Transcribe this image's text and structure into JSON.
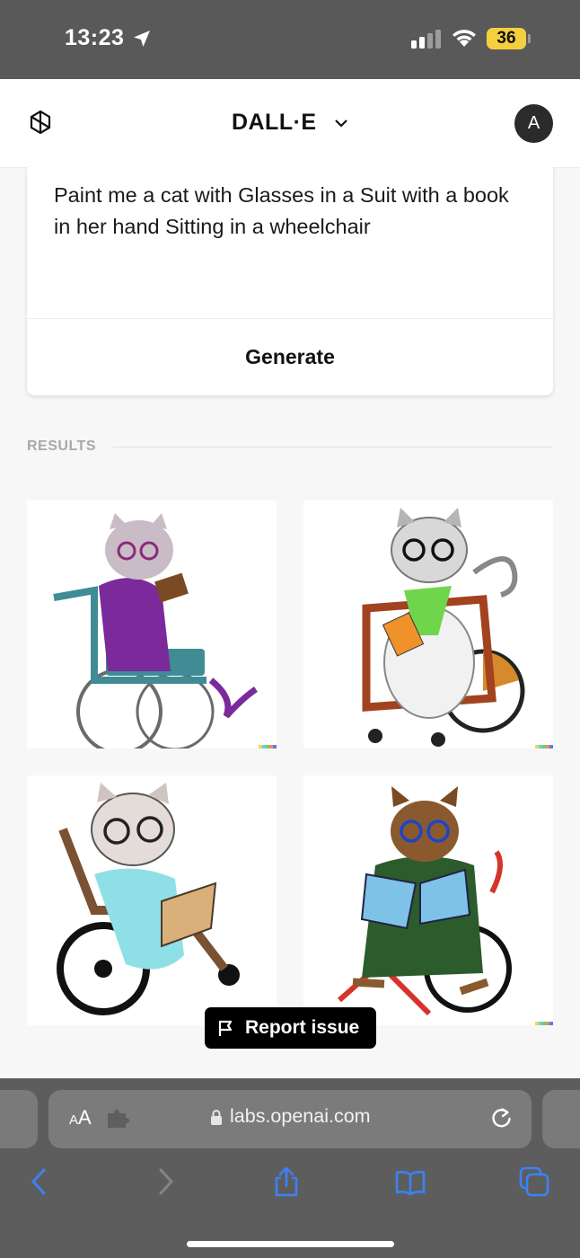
{
  "status_bar": {
    "time": "13:23",
    "battery": "36"
  },
  "header": {
    "title": "DALL·E",
    "avatar_initial": "A"
  },
  "prompt": {
    "text": "Paint me a cat with Glasses in a Suit with a book in her hand Sitting in a wheelchair",
    "generate_label": "Generate"
  },
  "results": {
    "label": "RESULTS",
    "images": [
      {
        "suit_color": "#7a2a9a",
        "chair_color": "#3f8c95"
      },
      {
        "suit_color": "#6fd64c",
        "chair_color": "#a3421f"
      },
      {
        "suit_color": "#8ee0e6",
        "chair_color": "#7a5132"
      },
      {
        "suit_color": "#2c5b2c",
        "chair_color": "#d6332a"
      }
    ]
  },
  "report_label": "Report issue",
  "browser": {
    "text_size_label": "AA",
    "url": "labs.openai.com"
  },
  "icons": [
    "location-arrow-icon",
    "signal-icon",
    "wifi-icon",
    "openai-logo-icon",
    "chevron-down-icon",
    "flag-icon",
    "puzzle-icon",
    "lock-icon",
    "reload-icon",
    "back-icon",
    "forward-icon",
    "share-icon",
    "bookmarks-icon",
    "tabs-icon"
  ]
}
